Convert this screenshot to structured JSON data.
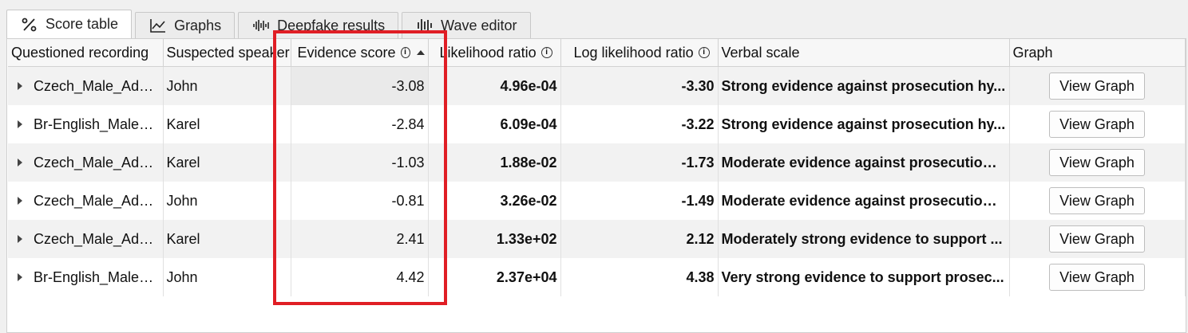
{
  "tabs": [
    {
      "label": "Score table",
      "icon": "percent-icon",
      "active": true
    },
    {
      "label": "Graphs",
      "icon": "line-chart-icon",
      "active": false
    },
    {
      "label": "Deepfake results",
      "icon": "waveform-icon",
      "active": false
    },
    {
      "label": "Wave editor",
      "icon": "wave-bars-icon",
      "active": false
    }
  ],
  "table": {
    "columns": [
      "Questioned recording",
      "Suspected speaker",
      "Evidence score",
      "Likelihood ratio",
      "Log likelihood ratio",
      "Verbal scale",
      "Graph"
    ],
    "rows": [
      {
        "recording": "Czech_Male_Adul...",
        "speaker": "John",
        "evidence": "-3.08",
        "lr": "4.96e-04",
        "llr": "-3.30",
        "verbal": "Strong evidence against prosecution hy...",
        "graph": "View Graph"
      },
      {
        "recording": "Br-English_Male_...",
        "speaker": "Karel",
        "evidence": "-2.84",
        "lr": "6.09e-04",
        "llr": "-3.22",
        "verbal": "Strong evidence against prosecution hy...",
        "graph": "View Graph"
      },
      {
        "recording": "Czech_Male_Adul...",
        "speaker": "Karel",
        "evidence": "-1.03",
        "lr": "1.88e-02",
        "llr": "-1.73",
        "verbal": "Moderate evidence against prosecution ...",
        "graph": "View Graph"
      },
      {
        "recording": "Czech_Male_Adul...",
        "speaker": "John",
        "evidence": "-0.81",
        "lr": "3.26e-02",
        "llr": "-1.49",
        "verbal": "Moderate evidence against prosecution ...",
        "graph": "View Graph"
      },
      {
        "recording": "Czech_Male_Adul...",
        "speaker": "Karel",
        "evidence": "2.41",
        "lr": "1.33e+02",
        "llr": "2.12",
        "verbal": "Moderately strong evidence to support ...",
        "graph": "View Graph"
      },
      {
        "recording": "Br-English_Male_...",
        "speaker": "John",
        "evidence": "4.42",
        "lr": "2.37e+04",
        "llr": "4.38",
        "verbal": "Very strong evidence to support prosec...",
        "graph": "View Graph"
      }
    ]
  },
  "colors": {
    "highlight": "#e01e25"
  }
}
